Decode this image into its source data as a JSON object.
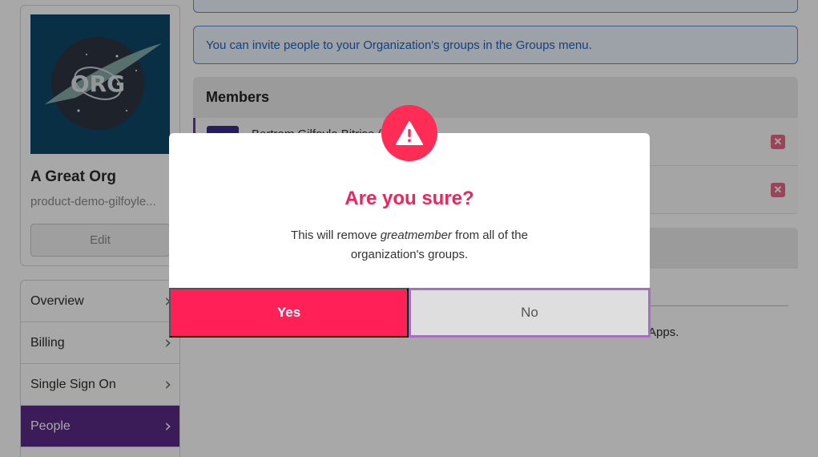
{
  "org": {
    "logo_text": "ORG",
    "name": "A Great Org",
    "slug": "product-demo-gilfoyle...",
    "edit_label": "Edit"
  },
  "nav": {
    "items": [
      {
        "label": "Overview",
        "active": false
      },
      {
        "label": "Billing",
        "active": false
      },
      {
        "label": "Single Sign On",
        "active": false
      },
      {
        "label": "People",
        "active": true
      }
    ]
  },
  "info": {
    "invite_text": "You can invite people to your Organization's groups in the Groups menu."
  },
  "members": {
    "header": "Members",
    "rows": [
      {
        "name_partial": "Bertram Gilfoyle Bitrise (Gilfoyle)"
      },
      {
        "name_partial": ""
      }
    ]
  },
  "section2": {
    "text_partial": "Apps."
  },
  "modal": {
    "icon": "warning-icon",
    "title": "Are you sure?",
    "message_before": "This will remove ",
    "member": "greatmember",
    "message_after": " from all of the organization's groups.",
    "yes_label": "Yes",
    "no_label": "No"
  },
  "colors": {
    "accent": "#ff2058",
    "title": "#f0235a",
    "nav_active": "#5a2a86",
    "info_text": "#2463b8"
  }
}
